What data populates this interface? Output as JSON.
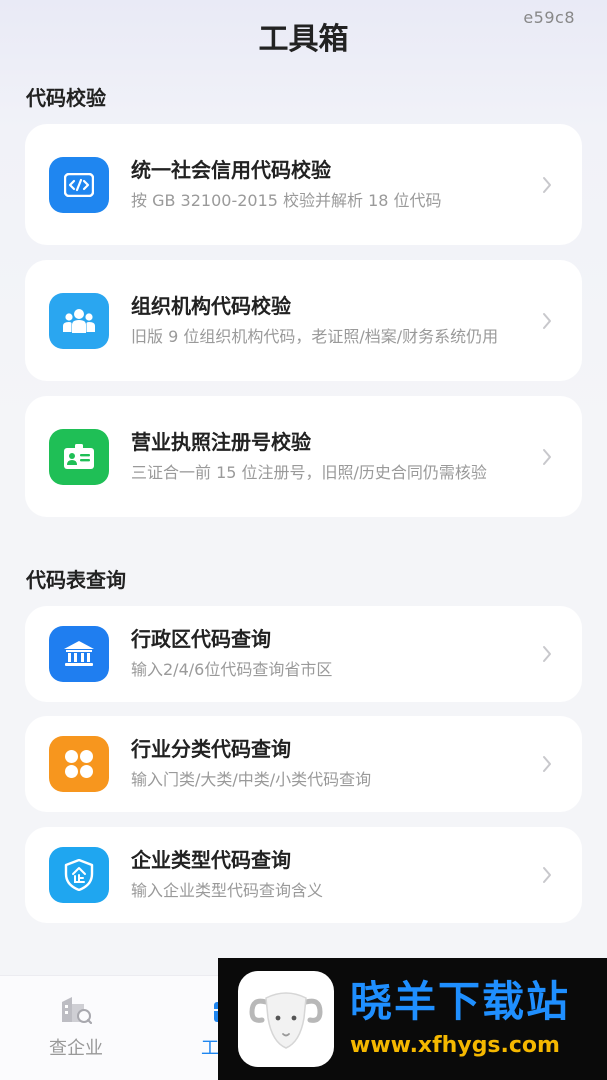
{
  "build_id": "e59c8",
  "page_title": "工具箱",
  "sections": [
    {
      "title": "代码校验",
      "items": [
        {
          "title": "统一社会信用代码校验",
          "desc": "按 GB 32100-2015 校验并解析 18 位代码",
          "icon": "code-icon",
          "color": "#1f86f0"
        },
        {
          "title": "组织机构代码校验",
          "desc": "旧版 9 位组织机构代码，老证照/档案/财务系统仍用",
          "icon": "people-icon",
          "color": "#2aa6f0"
        },
        {
          "title": "营业执照注册号校验",
          "desc": "三证合一前 15 位注册号，旧照/历史合同仍需核验",
          "icon": "id-card-icon",
          "color": "#1fbf56"
        }
      ]
    },
    {
      "title": "代码表查询",
      "items": [
        {
          "title": "行政区代码查询",
          "desc": "输入2/4/6位代码查询省市区",
          "icon": "government-building-icon",
          "color": "#1f7ef0"
        },
        {
          "title": "行业分类代码查询",
          "desc": "输入门类/大类/中类/小类代码查询",
          "icon": "four-leaf-icon",
          "color": "#f7961e"
        },
        {
          "title": "企业类型代码查询",
          "desc": "输入企业类型代码查询含义",
          "icon": "enterprise-shield-icon",
          "color": "#1fa6f0"
        }
      ]
    }
  ],
  "tabbar": {
    "tabs": [
      {
        "label": "查企业",
        "icon": "company-search-icon",
        "active": false
      },
      {
        "label": "工具箱",
        "icon": "toolbox-icon",
        "active": true
      }
    ]
  },
  "watermark": {
    "title": "晓羊下载站",
    "url": "www.xfhygs.com"
  }
}
